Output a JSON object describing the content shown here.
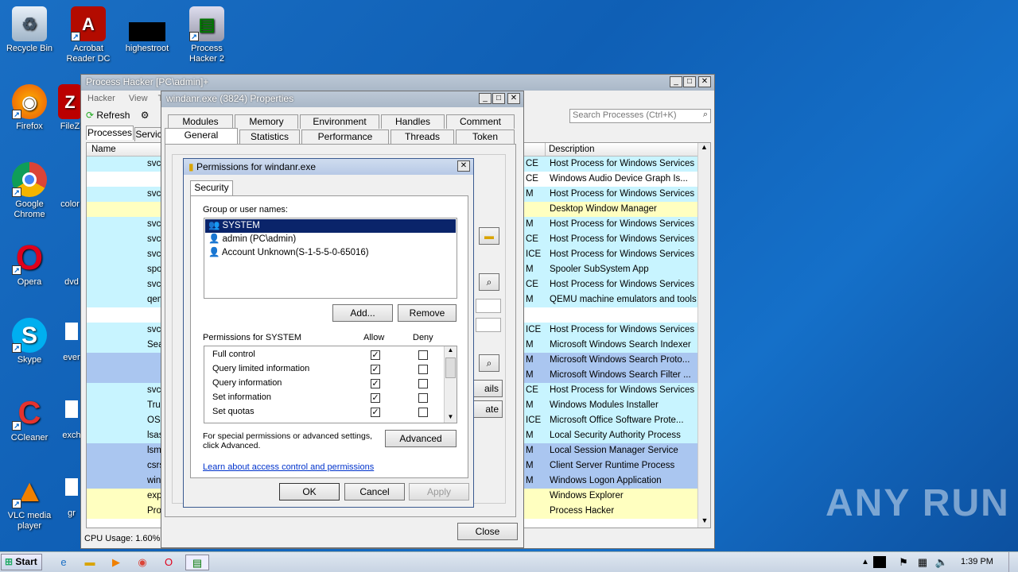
{
  "desktop": {
    "icons": [
      {
        "label": "Recycle Bin",
        "icon": "recycle-bin-icon"
      },
      {
        "label": "Acrobat Reader DC",
        "icon": "acrobat-icon"
      },
      {
        "label": "highestroot",
        "icon": "file-icon"
      },
      {
        "label": "Process Hacker 2",
        "icon": "process-hacker-icon"
      },
      {
        "label": "Firefox",
        "icon": "firefox-icon"
      },
      {
        "label": "FileZ",
        "icon": "filezilla-icon"
      },
      {
        "label": "Google Chrome",
        "icon": "chrome-icon"
      },
      {
        "label": "color",
        "icon": "file-icon"
      },
      {
        "label": "Opera",
        "icon": "opera-icon"
      },
      {
        "label": "dvd",
        "icon": "file-icon"
      },
      {
        "label": "Skype",
        "icon": "skype-icon"
      },
      {
        "label": "ever",
        "icon": "file-icon"
      },
      {
        "label": "CCleaner",
        "icon": "ccleaner-icon"
      },
      {
        "label": "exch",
        "icon": "file-icon"
      },
      {
        "label": "VLC media player",
        "icon": "vlc-icon"
      },
      {
        "label": "gr",
        "icon": "file-icon"
      }
    ]
  },
  "ph": {
    "title": "Process Hacker [PC\\admin]+",
    "menu": [
      "Hacker",
      "View",
      "To"
    ],
    "toolbar_refresh": "Refresh",
    "search_placeholder": "Search Processes (Ctrl+K)",
    "tab_processes": "Processes",
    "tab_services": "Servic",
    "col_name": "Name",
    "col_description": "Description",
    "status": "CPU Usage: 1.60%",
    "rows": [
      {
        "name": "svch",
        "desc": "Host Process for Windows Services",
        "mid": "CE",
        "color": "c-cyan"
      },
      {
        "name": "",
        "desc": "Windows Audio Device Graph Is...",
        "mid": "CE",
        "color": "c-white"
      },
      {
        "name": "svch",
        "desc": "Host Process for Windows Services",
        "mid": "M",
        "color": "c-cyan"
      },
      {
        "name": "",
        "desc": "Desktop Window Manager",
        "mid": "",
        "color": "c-yellow"
      },
      {
        "name": "svch",
        "desc": "Host Process for Windows Services",
        "mid": "M",
        "color": "c-cyan"
      },
      {
        "name": "svch",
        "desc": "Host Process for Windows Services",
        "mid": "CE",
        "color": "c-cyan"
      },
      {
        "name": "svch",
        "desc": "Host Process for Windows Services",
        "mid": "ICE",
        "color": "c-cyan"
      },
      {
        "name": "spoo",
        "desc": "Spooler SubSystem App",
        "mid": "M",
        "color": "c-cyan"
      },
      {
        "name": "svch",
        "desc": "Host Process for Windows Services",
        "mid": "CE",
        "color": "c-cyan"
      },
      {
        "name": "qem",
        "desc": "QEMU machine emulators and tools",
        "mid": "M",
        "color": "c-cyan"
      },
      {
        "name": "",
        "desc": "",
        "mid": "",
        "color": "c-white"
      },
      {
        "name": "svch",
        "desc": "Host Process for Windows Services",
        "mid": "ICE",
        "color": "c-cyan"
      },
      {
        "name": "Sea",
        "desc": "Microsoft Windows Search Indexer",
        "mid": "M",
        "color": "c-cyan"
      },
      {
        "name": "",
        "desc": "Microsoft Windows Search Proto...",
        "mid": "M",
        "color": "c-blue"
      },
      {
        "name": "",
        "desc": "Microsoft Windows Search Filter ...",
        "mid": "M",
        "color": "c-blue"
      },
      {
        "name": "svch",
        "desc": "Host Process for Windows Services",
        "mid": "CE",
        "color": "c-cyan"
      },
      {
        "name": "Trus",
        "desc": "Windows Modules Installer",
        "mid": "M",
        "color": "c-cyan"
      },
      {
        "name": "OSP",
        "desc": "Microsoft Office Software Prote...",
        "mid": "ICE",
        "color": "c-cyan"
      },
      {
        "name": "lsass.e",
        "desc": "Local Security Authority Process",
        "mid": "M",
        "color": "c-cyan"
      },
      {
        "name": "lsm.exe",
        "desc": "Local Session Manager Service",
        "mid": "M",
        "color": "c-blue"
      },
      {
        "name": "csrss.exe",
        "desc": "Client Server Runtime Process",
        "mid": "M",
        "color": "c-blue"
      },
      {
        "name": "winlogon.e",
        "desc": "Windows Logon Application",
        "mid": "M",
        "color": "c-blue"
      },
      {
        "name": "explorer.e",
        "desc": "Windows Explorer",
        "mid": "",
        "color": "c-yellow"
      },
      {
        "name": "ProcessHa",
        "desc": "Process Hacker",
        "mid": "",
        "color": "c-yellow"
      }
    ]
  },
  "props": {
    "title": "windanr.exe (3824) Properties",
    "tabs_row1": [
      "Modules",
      "Memory",
      "Environment",
      "Handles",
      "Comment"
    ],
    "tabs_row2": [
      "General",
      "Statistics",
      "Performance",
      "Threads",
      "Token"
    ],
    "side_btn_details": "ails",
    "side_btn_terminate": "ate",
    "close": "Close"
  },
  "perm": {
    "title": "Permissions for windanr.exe",
    "tab": "Security",
    "group_label": "Group or user names:",
    "users": [
      "SYSTEM",
      "admin (PC\\admin)",
      "Account Unknown(S-1-5-5-0-65016)"
    ],
    "add": "Add...",
    "remove": "Remove",
    "perms_label": "Permissions for SYSTEM",
    "allow": "Allow",
    "deny": "Deny",
    "perms": [
      {
        "name": "Full control",
        "allow": true,
        "deny": false
      },
      {
        "name": "Query limited information",
        "allow": true,
        "deny": false
      },
      {
        "name": "Query information",
        "allow": true,
        "deny": false
      },
      {
        "name": "Set information",
        "allow": true,
        "deny": false
      },
      {
        "name": "Set quotas",
        "allow": true,
        "deny": false
      }
    ],
    "special_text_1": "For special permissions or advanced settings,",
    "special_text_2": "click Advanced.",
    "advanced": "Advanced",
    "link": "Learn about access control and permissions",
    "ok": "OK",
    "cancel": "Cancel",
    "apply": "Apply"
  },
  "taskbar": {
    "start": "Start",
    "time": "1:39 PM"
  },
  "watermark": "ANY RUN"
}
